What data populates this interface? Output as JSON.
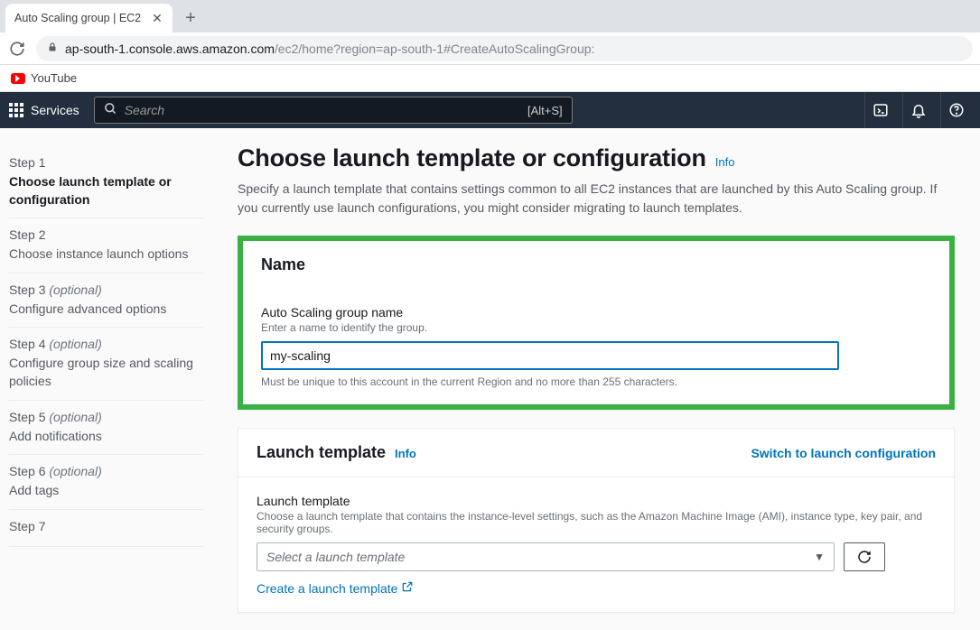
{
  "browser": {
    "tab_title": "Auto Scaling group | EC2",
    "url_domain": "ap-south-1.console.aws.amazon.com",
    "url_path": "/ec2/home?region=ap-south-1#CreateAutoScalingGroup:",
    "bookmark_youtube": "YouTube"
  },
  "nav": {
    "services": "Services",
    "search_placeholder": "Search",
    "search_hint": "[Alt+S]"
  },
  "steps": [
    {
      "num": "Step 1",
      "title": "Choose launch template or configuration",
      "optional": false,
      "active": true
    },
    {
      "num": "Step 2",
      "title": "Choose instance launch options",
      "optional": false,
      "active": false
    },
    {
      "num": "Step 3",
      "title": "Configure advanced options",
      "optional": true,
      "active": false
    },
    {
      "num": "Step 4",
      "title": "Configure group size and scaling policies",
      "optional": true,
      "active": false
    },
    {
      "num": "Step 5",
      "title": "Add notifications",
      "optional": true,
      "active": false
    },
    {
      "num": "Step 6",
      "title": "Add tags",
      "optional": true,
      "active": false
    },
    {
      "num": "Step 7",
      "title": "",
      "optional": false,
      "active": false
    }
  ],
  "optional_label": "(optional)",
  "page": {
    "title": "Choose launch template or configuration",
    "info": "Info",
    "description": "Specify a launch template that contains settings common to all EC2 instances that are launched by this Auto Scaling group. If you currently use launch configurations, you might consider migrating to launch templates."
  },
  "name_panel": {
    "header": "Name",
    "field_label": "Auto Scaling group name",
    "field_sub": "Enter a name to identify the group.",
    "field_value": "my-scaling",
    "field_hint": "Must be unique to this account in the current Region and no more than 255 characters."
  },
  "launch_panel": {
    "header": "Launch template",
    "info": "Info",
    "switch": "Switch to launch configuration",
    "field_label": "Launch template",
    "field_sub": "Choose a launch template that contains the instance-level settings, such as the Amazon Machine Image (AMI), instance type, key pair, and security groups.",
    "select_placeholder": "Select a launch template",
    "create_link": "Create a launch template"
  }
}
